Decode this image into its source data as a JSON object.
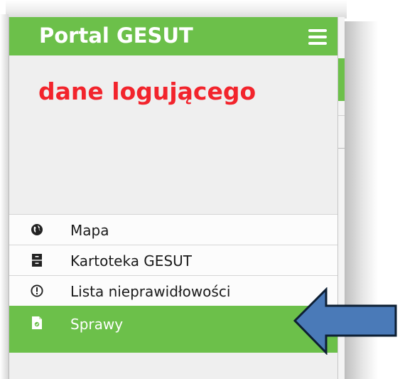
{
  "app": {
    "title": "Portal GESUT",
    "menu_icon": "hamburger-icon",
    "accent_color": "#6cc04a"
  },
  "user": {
    "label": "dane logującego",
    "label_color": "#f2242c"
  },
  "menu": {
    "items": [
      {
        "label": "Mapa",
        "icon": "globe-icon"
      },
      {
        "label": "Kartoteka GESUT",
        "icon": "file-cabinet-icon"
      },
      {
        "label": "Lista nieprawidłowości",
        "icon": "exclamation-circle-icon"
      },
      {
        "label": "Sprawy",
        "icon": "document-icon",
        "active": true
      }
    ]
  },
  "annotation": {
    "arrow_color": "#4a7ab8",
    "arrow_direction": "left"
  }
}
